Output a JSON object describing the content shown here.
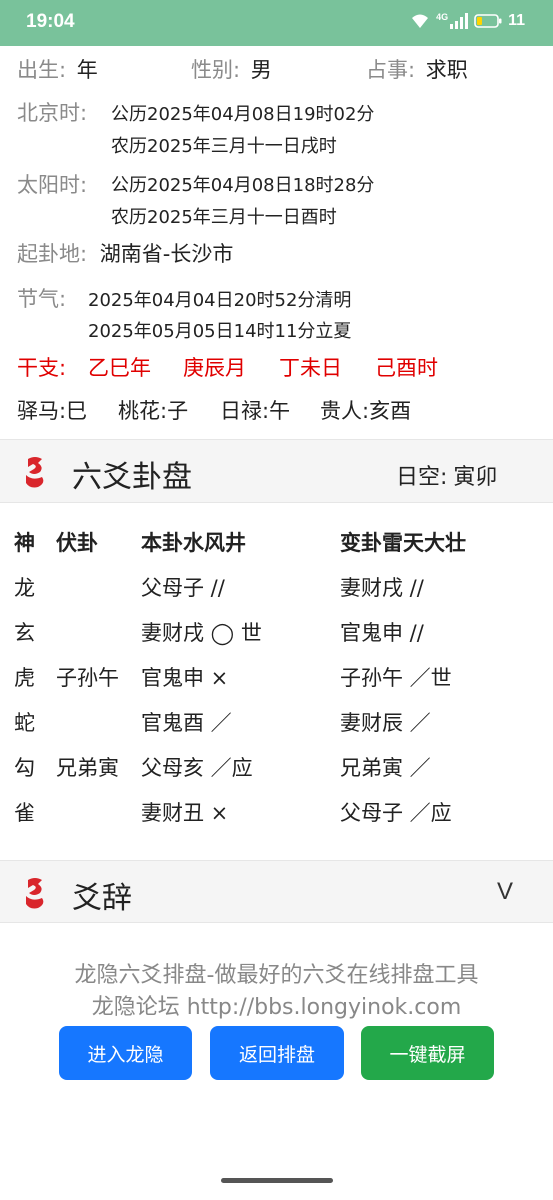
{
  "status": {
    "time": "19:04",
    "network": "4G",
    "battery": "11"
  },
  "birth": {
    "label_birth": "出生:",
    "birth_val": "年",
    "label_sex": "性别:",
    "sex_val": "男",
    "label_topic": "占事:",
    "topic_val": "求职"
  },
  "beijing": {
    "label": "北京时:",
    "line1": "公历2025年04月08日19时02分",
    "line2": "农历2025年三月十一日戌时"
  },
  "solar": {
    "label": "太阳时:",
    "line1": "公历2025年04月08日18时28分",
    "line2": "农历2025年三月十一日酉时"
  },
  "place": {
    "label": "起卦地:",
    "value": "湖南省-长沙市"
  },
  "jieqi": {
    "label": "节气:",
    "line1": "2025年04月04日20时52分清明",
    "line2": "2025年05月05日14时11分立夏"
  },
  "ganzhi": {
    "label": "干支:",
    "year": "乙巳年",
    "month": "庚辰月",
    "day": "丁未日",
    "hour": "己酉时"
  },
  "shensha": {
    "yima": "驿马:巳",
    "taohua": "桃花:子",
    "rilu": "日禄:午",
    "guiren": "贵人:亥酉"
  },
  "paipan": {
    "title": "六爻卦盘",
    "kong_label": "日空:",
    "kong_val": "寅卯"
  },
  "table": {
    "headers": {
      "shen": "神",
      "fu": "伏卦",
      "ben": "本卦水风井",
      "bian": "变卦雷天大壮"
    },
    "rows": [
      {
        "shen": "龙",
        "fu": "",
        "ben": "父母子 //",
        "bian": "妻财戌 //"
      },
      {
        "shen": "玄",
        "fu": "",
        "ben": "妻财戌 ◯ 世",
        "bian": "官鬼申 //"
      },
      {
        "shen": "虎",
        "fu": "子孙午",
        "ben": "官鬼申 ×",
        "bian": "子孙午 ／世"
      },
      {
        "shen": "蛇",
        "fu": "",
        "ben": "官鬼酉 ／",
        "bian": "妻财辰 ／"
      },
      {
        "shen": "勾",
        "fu": "兄弟寅",
        "ben": "父母亥 ／应",
        "bian": "兄弟寅 ／"
      },
      {
        "shen": "雀",
        "fu": "",
        "ben": "妻财丑 ×",
        "bian": "父母子 ／应"
      }
    ]
  },
  "yaoci": {
    "title": "爻辞",
    "toggle": "V"
  },
  "footer": {
    "line1": "龙隐六爻排盘-做最好的六爻在线排盘工具",
    "line2": "龙隐论坛 http://bbs.longyinok.com"
  },
  "buttons": {
    "enter": "进入龙隐",
    "back": "返回排盘",
    "screenshot": "一键截屏"
  },
  "colors": {
    "statusbar": "#79c29b",
    "red": "#e00000",
    "blue_button": "#1677ff",
    "green_button": "#23a84a"
  }
}
